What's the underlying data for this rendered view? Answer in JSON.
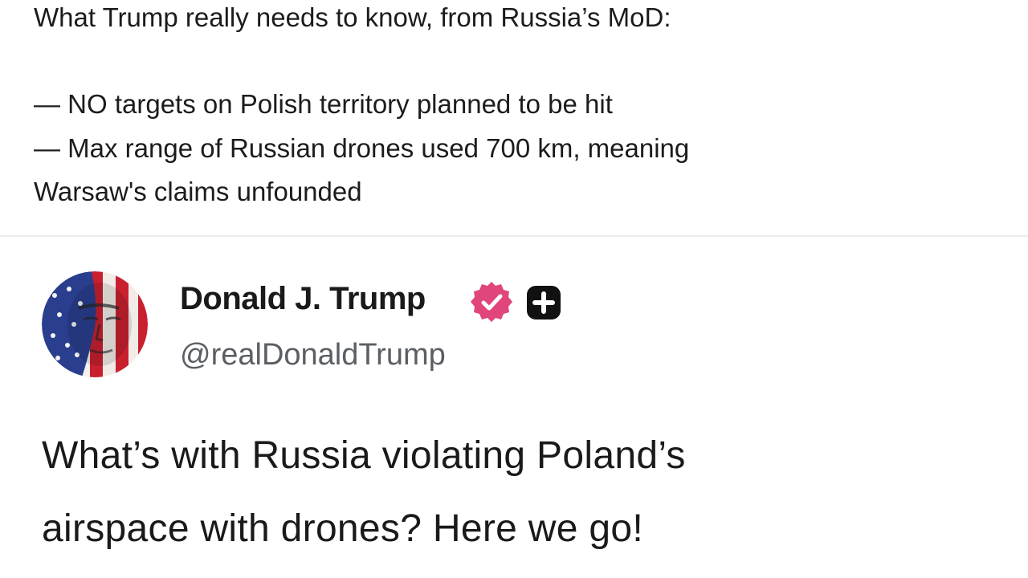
{
  "post": {
    "lines": [
      "What Trump really needs to know, from Russia’s MoD:",
      "— NO targets on Polish territory planned to be hit",
      "— Max range of Russian drones used 700 km, meaning",
      "Warsaw's claims unfounded"
    ]
  },
  "embed": {
    "author_name": "Donald J. Trump",
    "handle": "@realDonaldTrump",
    "verified_icon": "verified-badge-icon",
    "plus_icon": "plus-badge-icon",
    "text_lines": [
      "What’s with Russia violating Poland’s",
      "airspace with drones? Here we go!"
    ],
    "colors": {
      "verified": "#e0457b",
      "handle": "#5b5f64"
    }
  }
}
